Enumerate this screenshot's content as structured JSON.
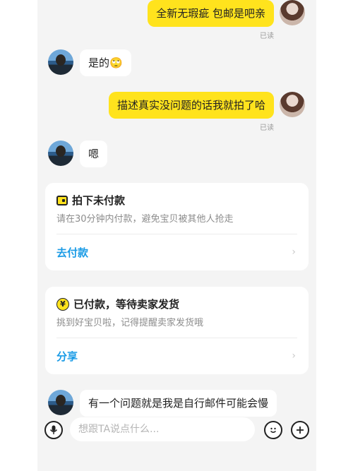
{
  "messages": [
    {
      "side": "me",
      "text": "全新无瑕疵 包邮是吧亲",
      "read": "已读"
    },
    {
      "side": "them",
      "text": "是的"
    },
    {
      "side": "me",
      "text": "描述真实没问题的话我就拍了哈",
      "read": "已读"
    },
    {
      "side": "them",
      "text": "嗯"
    },
    {
      "side": "them",
      "text": "有一个问题就是我是自行邮件可能会慢"
    }
  ],
  "emoji_glyph": "🙄",
  "cards": [
    {
      "icon": "wallet-icon",
      "title": "拍下未付款",
      "subtitle": "请在30分钟内付款，避免宝贝被其他人抢走",
      "action": "去付款"
    },
    {
      "icon": "yen-icon",
      "title": "已付款，等待卖家发货",
      "subtitle": "挑到好宝贝啦，记得提醒卖家发货哦",
      "action": "分享"
    }
  ],
  "yen_symbol": "¥",
  "chevron": "›",
  "input": {
    "placeholder": "想跟TA说点什么..."
  },
  "icons": {
    "mic": "microphone-icon",
    "emoji": "emoji-icon",
    "plus": "plus-icon"
  },
  "colors": {
    "accent_yellow": "#ffe31d",
    "link_blue": "#1a9be6",
    "background": "#f4f4f4"
  }
}
